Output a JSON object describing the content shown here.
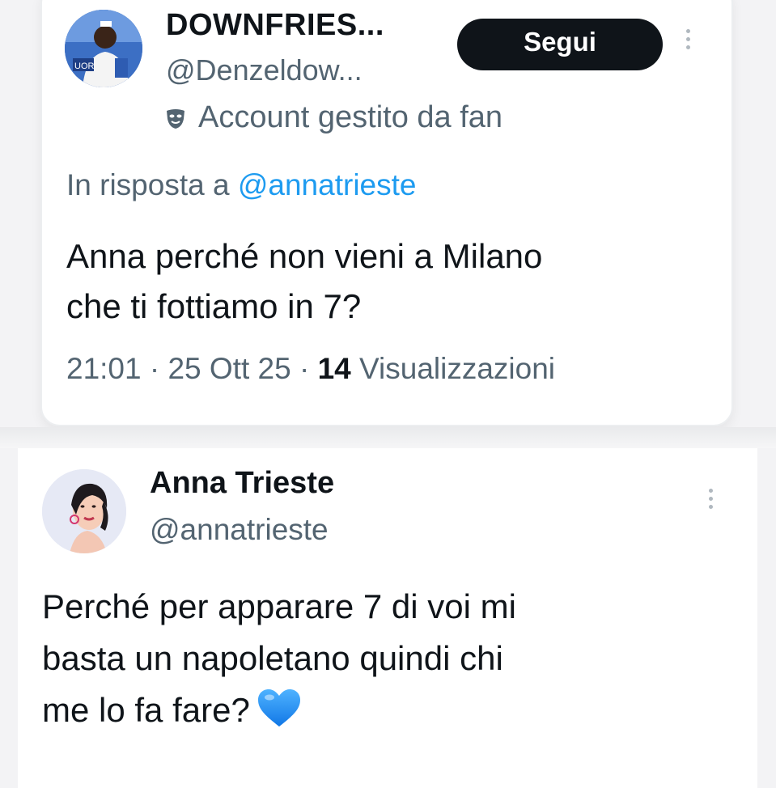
{
  "reply_tweet": {
    "display_name": "DOWNFRIES...",
    "handle": "@Denzeldow...",
    "follow_label": "Segui",
    "account_label": "Account gestito da fan",
    "in_reply_prefix": "In risposta a ",
    "in_reply_handle": "@annatrieste",
    "text_lines": [
      "Anna perché non vieni a Milano",
      "che ti fottiamo in 7?"
    ],
    "time": "21:01",
    "date": "25 Ott 25",
    "views_count": "14",
    "views_label": "Visualizzazioni",
    "avatar_icon": "profile-photo-man-blue-shirt"
  },
  "original_tweet": {
    "display_name": "Anna Trieste",
    "handle": "@annatrieste",
    "text_lines": [
      "Perché per apparare 7 di voi mi",
      "basta un napoletano quindi chi",
      "me lo fa fare?"
    ],
    "emoji": "blue-heart-icon",
    "avatar_icon": "illustrated-woman-portrait"
  },
  "colors": {
    "text_primary": "#0f1419",
    "text_secondary": "#536471",
    "link": "#1d9bf0",
    "follow_bg": "#0f1419",
    "heart": "#1d8ff0"
  }
}
